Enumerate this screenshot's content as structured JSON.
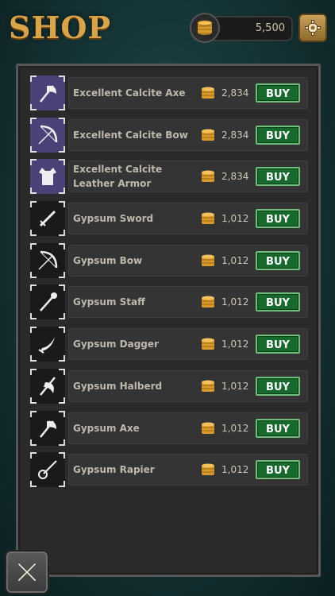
{
  "header": {
    "title": "SHOP",
    "currency": "5,500"
  },
  "items": [
    {
      "name": "Excellent Calcite Axe",
      "price": "2,834",
      "buy": "BUY",
      "icon": "axe-icon",
      "tier": "excellent"
    },
    {
      "name": "Excellent Calcite Bow",
      "price": "2,834",
      "buy": "BUY",
      "icon": "bow-icon",
      "tier": "excellent"
    },
    {
      "name": "Excellent Calcite Leather Armor",
      "price": "2,834",
      "buy": "BUY",
      "icon": "armor-icon",
      "tier": "excellent"
    },
    {
      "name": "Gypsum Sword",
      "price": "1,012",
      "buy": "BUY",
      "icon": "sword-icon",
      "tier": "normal"
    },
    {
      "name": "Gypsum Bow",
      "price": "1,012",
      "buy": "BUY",
      "icon": "bow-icon",
      "tier": "normal"
    },
    {
      "name": "Gypsum Staff",
      "price": "1,012",
      "buy": "BUY",
      "icon": "staff-icon",
      "tier": "normal"
    },
    {
      "name": "Gypsum Dagger",
      "price": "1,012",
      "buy": "BUY",
      "icon": "dagger-icon",
      "tier": "normal"
    },
    {
      "name": "Gypsum Halberd",
      "price": "1,012",
      "buy": "BUY",
      "icon": "halberd-icon",
      "tier": "normal"
    },
    {
      "name": "Gypsum Axe",
      "price": "1,012",
      "buy": "BUY",
      "icon": "axe-icon",
      "tier": "normal"
    },
    {
      "name": "Gypsum Rapier",
      "price": "1,012",
      "buy": "BUY",
      "icon": "rapier-icon",
      "tier": "normal"
    }
  ],
  "colors": {
    "accent": "#d9a348",
    "buy": "#17692e",
    "panel": "#2a2a2a"
  }
}
